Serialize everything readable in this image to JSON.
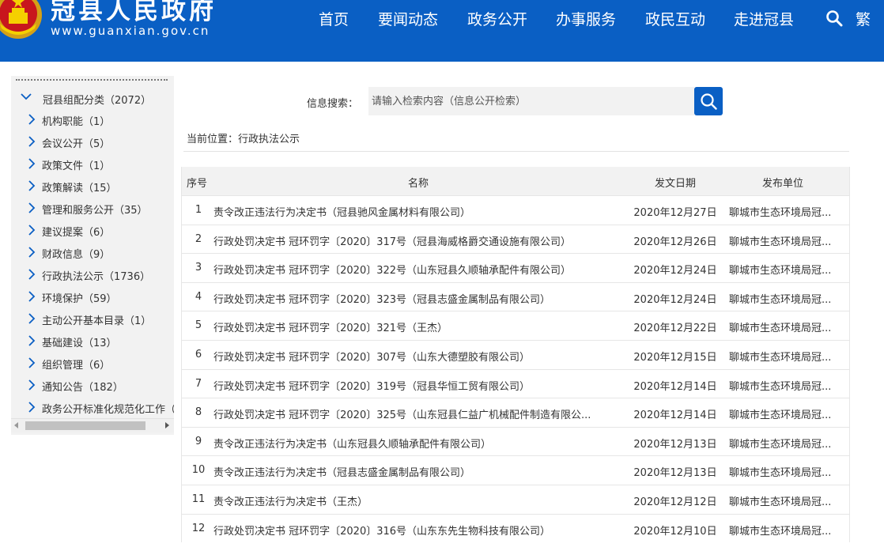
{
  "header": {
    "site_title": "冠县人民政府",
    "site_url": "www.guanxian.gov.cn",
    "nav": [
      "首页",
      "要闻动态",
      "政务公开",
      "办事服务",
      "政民互动",
      "走进冠县"
    ],
    "traditional_label": "繁",
    "brand_color": "#0a5fc4"
  },
  "sidebar": {
    "root": "冠县组配分类（2072）",
    "items": [
      "机构职能（1）",
      "会议公开（5）",
      "政策文件（1）",
      "政策解读（15）",
      "管理和服务公开（35）",
      "建议提案（6）",
      "财政信息（9）",
      "行政执法公示（1736）",
      "环境保护（59）",
      "主动公开基本目录（1）",
      "基础建设（13）",
      "组织管理（6）",
      "通知公告（182）",
      "政务公开标准化规范化工作（"
    ]
  },
  "search": {
    "label": "信息搜索：",
    "placeholder": "请输入检索内容（信息公开检索）"
  },
  "breadcrumb": "当前位置：行政执法公示",
  "table": {
    "headers": [
      "序号",
      "名称",
      "发文日期",
      "发布单位"
    ],
    "rows": [
      {
        "no": "1",
        "title": "责令改正违法行为决定书（冠县驰风金属材料有限公司）",
        "date": "2020年12月27日",
        "org": "聊城市生态环境局冠..."
      },
      {
        "no": "2",
        "title": "行政处罚决定书 冠环罚字〔2020〕317号（冠县海威格爵交通设施有限公司）",
        "date": "2020年12月26日",
        "org": "聊城市生态环境局冠..."
      },
      {
        "no": "3",
        "title": "行政处罚决定书 冠环罚字〔2020〕322号（山东冠县久顺轴承配件有限公司）",
        "date": "2020年12月24日",
        "org": "聊城市生态环境局冠..."
      },
      {
        "no": "4",
        "title": "行政处罚决定书 冠环罚字〔2020〕323号（冠县志盛金属制品有限公司）",
        "date": "2020年12月24日",
        "org": "聊城市生态环境局冠..."
      },
      {
        "no": "5",
        "title": "行政处罚决定书 冠环罚字〔2020〕321号（王杰）",
        "date": "2020年12月22日",
        "org": "聊城市生态环境局冠..."
      },
      {
        "no": "6",
        "title": "行政处罚决定书 冠环罚字〔2020〕307号（山东大德塑胶有限公司）",
        "date": "2020年12月15日",
        "org": "聊城市生态环境局冠..."
      },
      {
        "no": "7",
        "title": "行政处罚决定书 冠环罚字〔2020〕319号（冠县华恒工贸有限公司）",
        "date": "2020年12月14日",
        "org": "聊城市生态环境局冠..."
      },
      {
        "no": "8",
        "title": "行政处罚决定书 冠环罚字〔2020〕325号（山东冠县仁益广机械配件制造有限公...",
        "date": "2020年12月14日",
        "org": "聊城市生态环境局冠..."
      },
      {
        "no": "9",
        "title": "责令改正违法行为决定书（山东冠县久顺轴承配件有限公司）",
        "date": "2020年12月13日",
        "org": "聊城市生态环境局冠..."
      },
      {
        "no": "10",
        "title": "责令改正违法行为决定书（冠县志盛金属制品有限公司）",
        "date": "2020年12月13日",
        "org": "聊城市生态环境局冠..."
      },
      {
        "no": "11",
        "title": "责令改正违法行为决定书（王杰）",
        "date": "2020年12月12日",
        "org": "聊城市生态环境局冠..."
      },
      {
        "no": "12",
        "title": "行政处罚决定书 冠环罚字〔2020〕316号（山东东先生物科技有限公司）",
        "date": "2020年12月10日",
        "org": "聊城市生态环境局冠..."
      }
    ]
  }
}
